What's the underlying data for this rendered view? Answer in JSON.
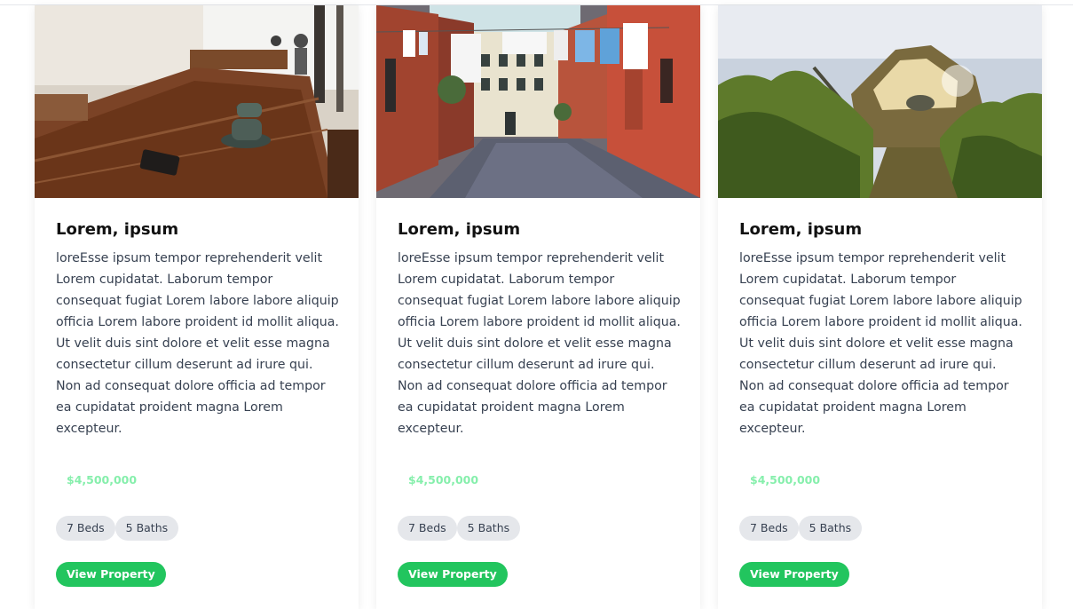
{
  "cards": [
    {
      "image": "cafe-wooden-table-coffee-cup",
      "title": "Lorem, ipsum",
      "description": "loreEsse ipsum tempor reprehenderit velit Lorem cupidatat. Laborum tempor consequat fugiat Lorem labore labore aliquip officia Lorem labore proident id mollit aliqua. Ut velit duis sint dolore et velit esse magna consectetur cillum deserunt ad irure qui. Non ad consequat dolore officia ad tempor ea cupidatat proident magna Lorem excepteur.",
      "price": "$4,500,000",
      "beds": "7 Beds",
      "baths": "5 Baths",
      "button": "View Property"
    },
    {
      "image": "venice-street-laundry",
      "title": "Lorem, ipsum",
      "description": "loreEsse ipsum tempor reprehenderit velit Lorem cupidatat. Laborum tempor consequat fugiat Lorem labore labore aliquip officia Lorem labore proident id mollit aliqua. Ut velit duis sint dolore et velit esse magna consectetur cillum deserunt ad irure qui. Non ad consequat dolore officia ad tempor ea cupidatat proident magna Lorem excepteur.",
      "price": "$4,500,000",
      "beds": "7 Beds",
      "baths": "5 Baths",
      "button": "View Property"
    },
    {
      "image": "rowboat-lake-greenery",
      "title": "Lorem, ipsum",
      "description": "loreEsse ipsum tempor reprehenderit velit Lorem cupidatat. Laborum tempor consequat fugiat Lorem labore labore aliquip officia Lorem labore proident id mollit aliqua. Ut velit duis sint dolore et velit esse magna consectetur cillum deserunt ad irure qui. Non ad consequat dolore officia ad tempor ea cupidatat proident magna Lorem excepteur.",
      "price": "$4,500,000",
      "beds": "7 Beds",
      "baths": "5 Baths",
      "button": "View Property"
    }
  ],
  "colors": {
    "price": "#86efac",
    "button": "#22c55e",
    "tag_bg": "#e5e7eb"
  }
}
